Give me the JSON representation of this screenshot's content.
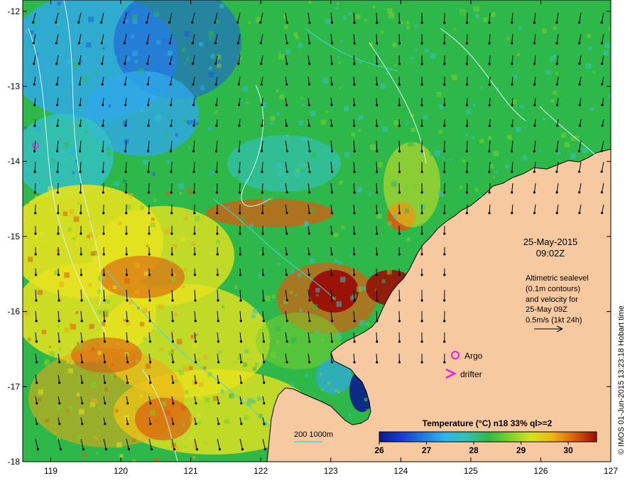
{
  "map": {
    "lon_range": [
      118.6,
      127.0
    ],
    "lat_range": [
      -18.0,
      -11.85
    ],
    "x_ticks": [
      119,
      120,
      121,
      122,
      123,
      124,
      125,
      126,
      127
    ],
    "y_ticks": [
      -12,
      -13,
      -14,
      -15,
      -16,
      -17,
      -18
    ],
    "x_tick_labels": [
      "119",
      "120",
      "121",
      "122",
      "123",
      "124",
      "125",
      "126",
      "127"
    ],
    "y_tick_labels": [
      "-12",
      "-13",
      "-14",
      "-15",
      "-16",
      "-17",
      "-18"
    ],
    "land_color": "#f6c9a0",
    "sst_palette": [
      "#081c8c",
      "#1f60d8",
      "#2fa8e8",
      "#33c1c8",
      "#2fb84a",
      "#7ccf2c",
      "#e6e21e",
      "#f0a814",
      "#d85c10",
      "#9a0d06"
    ]
  },
  "date_label": {
    "line1": "25-May-2015",
    "line2": "09:02Z"
  },
  "altimetry_note": {
    "lines": [
      "Altimetric sealevel",
      "(0.1m contours)",
      "and velocity for",
      "25-May 09Z",
      "0.5m/s (1kt 24h)"
    ]
  },
  "legend": {
    "argo_label": "Argo",
    "drifter_label": "drifter",
    "argo_symbol_color": "#e020e0",
    "drifter_symbol_color": "#e020e0"
  },
  "depth_legend": {
    "label": "200  1000m",
    "color_200": "#40d8d8",
    "color_1000": "#b0f0f0"
  },
  "colorbar": {
    "title": "Temperature (°C) n18 33% ql>=2",
    "min": 26.0,
    "max": 30.6,
    "ticks": [
      26,
      27,
      28,
      29,
      30
    ],
    "tick_labels": [
      "26",
      "27",
      "28",
      "29",
      "30"
    ]
  },
  "credit": "© IMOS 01-Jun-2015 13:23:18 Hobart time"
}
